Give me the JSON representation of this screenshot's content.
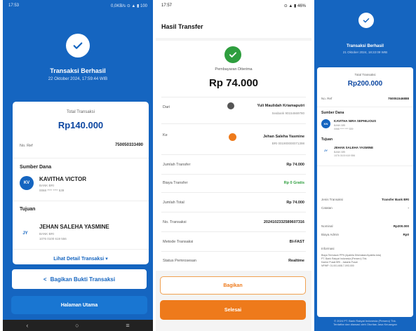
{
  "panel1": {
    "status_time": "17:53",
    "status_right": "0,0KB/s ⊙ ▲ ▮ 100",
    "title": "Transaksi Berhasil",
    "date": "22 Oktober 2024, 17:59:44 WIB",
    "total_label": "Total Transaksi",
    "total_amount": "Rp140.000",
    "ref_label": "No. Ref",
    "ref_value": "750050333490",
    "source_section": "Sumber Dana",
    "source_initials": "KV",
    "source_name": "KAVITHA VICTOR",
    "source_bank": "BANK BRI",
    "source_account": "0068 **** **** 539",
    "dest_section": "Tujuan",
    "dest_initials": "JY",
    "dest_name": "JEHAN SALEHA YASMINE",
    "dest_bank": "BANK BRI",
    "dest_account": "1076 0100 619 556",
    "detail_link": "Lihat Detail Transaksi ▾",
    "share_button": "Bagikan Bukti Transaksi",
    "home_button": "Halaman Utama",
    "colors": {
      "brand": "#1565c0",
      "accent": "#1976d2"
    }
  },
  "panel2": {
    "status_time": "17:57",
    "status_right": "⊙ ▲ ▮ 46%",
    "header_title": "Hasil Transfer",
    "status_text": "Pembayaran Diterima",
    "amount": "Rp 74.000",
    "from_label": "Dari",
    "from_name": "Yuli Maulidah Kriamaputri",
    "from_bank": "Seabank  90154669780",
    "to_label": "Ke",
    "to_name": "Jehan Saleha Yasmine",
    "to_account": "BRI 001900000071398",
    "rows": [
      {
        "label": "Jumlah Transfer",
        "value": "Rp 74.000"
      },
      {
        "label": "Biaya Transfer",
        "value": "Rp 0 Gratis"
      },
      {
        "label": "Jumlah Total",
        "value": "Rp 74.000"
      },
      {
        "label": "No. Transaksi",
        "value": "2024102332589607316"
      },
      {
        "label": "Metode Transaksi",
        "value": "BI-FAST"
      },
      {
        "label": "Status Pemrosesan",
        "value": "Realtime"
      }
    ],
    "share_button": "Bagikan",
    "done_button": "Selesai",
    "colors": {
      "success": "#2e9e3e",
      "accent": "#ee7a1b"
    }
  },
  "panel3": {
    "title": "Transaksi Berhasil",
    "date": "21 Oktober 2024, 18:22:09 WIB",
    "total_label": "Total Transaksi",
    "total_amount": "Rp200.000",
    "ref_label": "No. Ref",
    "ref_value": "750051546888",
    "source_section": "Sumber Dana",
    "source_initials": "KN",
    "source_name": "KAVITHA NIRA SEPHILIOUS",
    "source_bank": "BANK BRI",
    "source_account": "0068 **** **** 539",
    "dest_section": "Tujuan",
    "dest_initials": "JY",
    "dest_name": "JEHAN SALEHA YASMINE",
    "dest_bank": "BANK BRI",
    "dest_account": "1076 0100 619 556",
    "rows": [
      {
        "label": "Jenis Transaksi",
        "value": "Transfer Bank BRI"
      },
      {
        "label": "Catatan",
        "value": "-"
      },
      {
        "label": "Nominal",
        "value": "Rp200.000"
      },
      {
        "label": "Biaya Admin",
        "value": "Rp0"
      }
    ],
    "info_title": "Informasi",
    "info_text": "Biaya Termasuk PPN (Apabila Dikenakan/Apabila Ada)\nPT. Bank Rakyat Indonesia (Persero) Tbk.\nKantor Pusat BRI - Jakarta Pusat\nNPWP: 01.001.608.7-093.000",
    "footer": "© 2024 PT. Bank Rakyat Indonesia (Persero) Tbk.\nTerdaftar dan diawasi oleh Otoritas Jasa Keuangan"
  }
}
